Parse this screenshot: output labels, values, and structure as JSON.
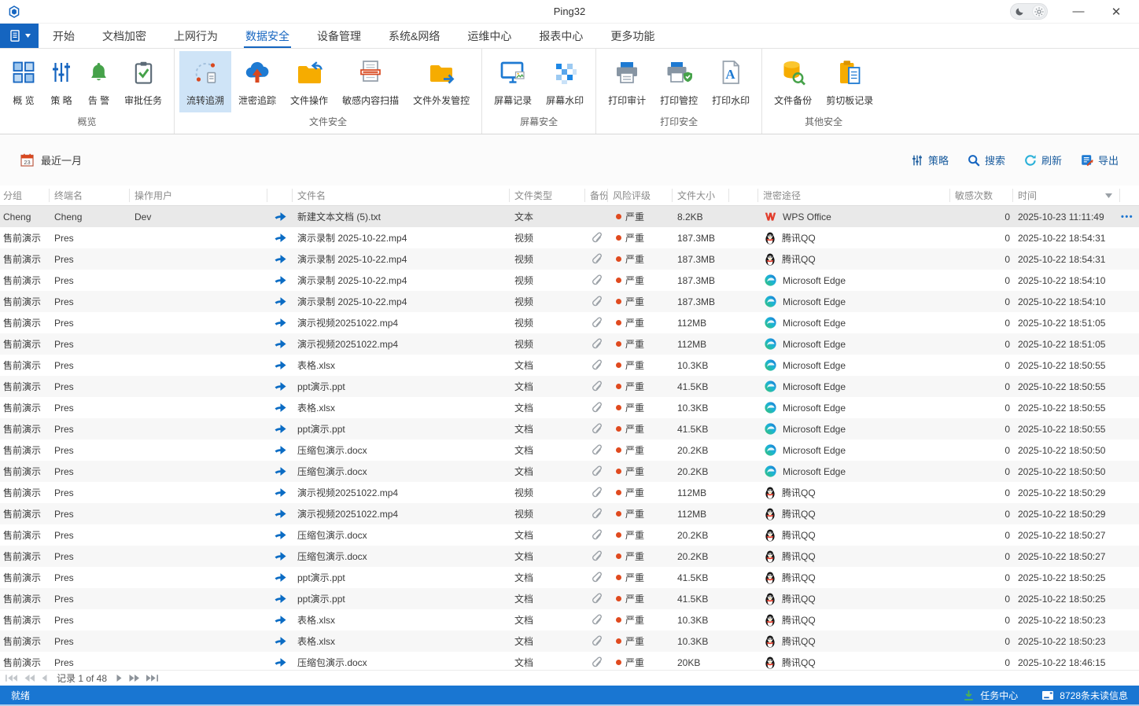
{
  "window": {
    "title": "Ping32"
  },
  "tabs": {
    "active_index": 3,
    "items": [
      {
        "label": "开始"
      },
      {
        "label": "文档加密"
      },
      {
        "label": "上网行为"
      },
      {
        "label": "数据安全"
      },
      {
        "label": "设备管理"
      },
      {
        "label": "系统&网络"
      },
      {
        "label": "运维中心"
      },
      {
        "label": "报表中心"
      },
      {
        "label": "更多功能"
      }
    ]
  },
  "ribbon": {
    "groups": [
      {
        "label": "概览",
        "tools": [
          {
            "label": "概 览",
            "icon": "overview-grid"
          },
          {
            "label": "策 略",
            "icon": "sliders"
          },
          {
            "label": "告 警",
            "icon": "bell"
          },
          {
            "label": "审批任务",
            "icon": "clipboard-check"
          }
        ]
      },
      {
        "label": "文件安全",
        "tools": [
          {
            "label": "流转追溯",
            "icon": "trace-cycle",
            "selected": true
          },
          {
            "label": "泄密追踪",
            "icon": "leak-cloud"
          },
          {
            "label": "文件操作",
            "icon": "folder-back"
          },
          {
            "label": "敏感内容扫描",
            "icon": "doc-scan"
          },
          {
            "label": "文件外发管控",
            "icon": "folder-send"
          }
        ]
      },
      {
        "label": "屏幕安全",
        "tools": [
          {
            "label": "屏幕记录",
            "icon": "screen-record"
          },
          {
            "label": "屏幕水印",
            "icon": "watermark-mosaic"
          }
        ]
      },
      {
        "label": "打印安全",
        "tools": [
          {
            "label": "打印审计",
            "icon": "printer"
          },
          {
            "label": "打印管控",
            "icon": "printer-shield"
          },
          {
            "label": "打印水印",
            "icon": "doc-a"
          }
        ]
      },
      {
        "label": "其他安全",
        "tools": [
          {
            "label": "文件备份",
            "icon": "db-search"
          },
          {
            "label": "剪切板记录",
            "icon": "clipboard-doc"
          }
        ]
      }
    ]
  },
  "filterbar": {
    "date_range": "最近一月",
    "calendar_day": "23",
    "actions": [
      {
        "label": "策略",
        "icon": "sliders-sm"
      },
      {
        "label": "搜索",
        "icon": "search"
      },
      {
        "label": "刷新",
        "icon": "refresh"
      },
      {
        "label": "导出",
        "icon": "export"
      }
    ]
  },
  "table": {
    "columns": [
      {
        "key": "group",
        "label": "分组"
      },
      {
        "key": "terminal",
        "label": "终端名"
      },
      {
        "key": "user",
        "label": "操作用户"
      },
      {
        "key": "arrow",
        "label": ""
      },
      {
        "key": "file",
        "label": "文件名"
      },
      {
        "key": "type",
        "label": "文件类型"
      },
      {
        "key": "backup",
        "label": "备份"
      },
      {
        "key": "risk",
        "label": "风险评级"
      },
      {
        "key": "size",
        "label": "文件大小"
      },
      {
        "key": "gap",
        "label": ""
      },
      {
        "key": "channel",
        "label": "泄密途径"
      },
      {
        "key": "count",
        "label": "敏感次数"
      },
      {
        "key": "time",
        "label": "时间",
        "sortable": true
      },
      {
        "key": "actions",
        "label": ""
      }
    ],
    "rows": [
      {
        "group": "Cheng",
        "terminal": "Cheng",
        "user": "Dev",
        "file": "新建文本文档 (5).txt",
        "type": "文本",
        "backup": false,
        "risk": "严重",
        "size": "8.2KB",
        "channel": "WPS Office",
        "channel_icon": "wps",
        "count": "0",
        "time": "2025-10-23 11:11:49",
        "selected": true
      },
      {
        "group": "售前演示",
        "terminal": "Pres",
        "user": "",
        "file": "演示录制 2025-10-22.mp4",
        "type": "视频",
        "backup": true,
        "risk": "严重",
        "size": "187.3MB",
        "channel": "腾讯QQ",
        "channel_icon": "qq",
        "count": "0",
        "time": "2025-10-22 18:54:31"
      },
      {
        "group": "售前演示",
        "terminal": "Pres",
        "user": "",
        "file": "演示录制 2025-10-22.mp4",
        "type": "视频",
        "backup": true,
        "risk": "严重",
        "size": "187.3MB",
        "channel": "腾讯QQ",
        "channel_icon": "qq",
        "count": "0",
        "time": "2025-10-22 18:54:31"
      },
      {
        "group": "售前演示",
        "terminal": "Pres",
        "user": "",
        "file": "演示录制 2025-10-22.mp4",
        "type": "视频",
        "backup": true,
        "risk": "严重",
        "size": "187.3MB",
        "channel": "Microsoft Edge",
        "channel_icon": "edge",
        "count": "0",
        "time": "2025-10-22 18:54:10"
      },
      {
        "group": "售前演示",
        "terminal": "Pres",
        "user": "",
        "file": "演示录制 2025-10-22.mp4",
        "type": "视频",
        "backup": true,
        "risk": "严重",
        "size": "187.3MB",
        "channel": "Microsoft Edge",
        "channel_icon": "edge",
        "count": "0",
        "time": "2025-10-22 18:54:10"
      },
      {
        "group": "售前演示",
        "terminal": "Pres",
        "user": "",
        "file": "演示视频20251022.mp4",
        "type": "视频",
        "backup": true,
        "risk": "严重",
        "size": "112MB",
        "channel": "Microsoft Edge",
        "channel_icon": "edge",
        "count": "0",
        "time": "2025-10-22 18:51:05"
      },
      {
        "group": "售前演示",
        "terminal": "Pres",
        "user": "",
        "file": "演示视频20251022.mp4",
        "type": "视频",
        "backup": true,
        "risk": "严重",
        "size": "112MB",
        "channel": "Microsoft Edge",
        "channel_icon": "edge",
        "count": "0",
        "time": "2025-10-22 18:51:05"
      },
      {
        "group": "售前演示",
        "terminal": "Pres",
        "user": "",
        "file": "表格.xlsx",
        "type": "文档",
        "backup": true,
        "risk": "严重",
        "size": "10.3KB",
        "channel": "Microsoft Edge",
        "channel_icon": "edge",
        "count": "0",
        "time": "2025-10-22 18:50:55"
      },
      {
        "group": "售前演示",
        "terminal": "Pres",
        "user": "",
        "file": "ppt演示.ppt",
        "type": "文档",
        "backup": true,
        "risk": "严重",
        "size": "41.5KB",
        "channel": "Microsoft Edge",
        "channel_icon": "edge",
        "count": "0",
        "time": "2025-10-22 18:50:55"
      },
      {
        "group": "售前演示",
        "terminal": "Pres",
        "user": "",
        "file": "表格.xlsx",
        "type": "文档",
        "backup": true,
        "risk": "严重",
        "size": "10.3KB",
        "channel": "Microsoft Edge",
        "channel_icon": "edge",
        "count": "0",
        "time": "2025-10-22 18:50:55"
      },
      {
        "group": "售前演示",
        "terminal": "Pres",
        "user": "",
        "file": "ppt演示.ppt",
        "type": "文档",
        "backup": true,
        "risk": "严重",
        "size": "41.5KB",
        "channel": "Microsoft Edge",
        "channel_icon": "edge",
        "count": "0",
        "time": "2025-10-22 18:50:55"
      },
      {
        "group": "售前演示",
        "terminal": "Pres",
        "user": "",
        "file": "压缩包演示.docx",
        "type": "文档",
        "backup": true,
        "risk": "严重",
        "size": "20.2KB",
        "channel": "Microsoft Edge",
        "channel_icon": "edge",
        "count": "0",
        "time": "2025-10-22 18:50:50"
      },
      {
        "group": "售前演示",
        "terminal": "Pres",
        "user": "",
        "file": "压缩包演示.docx",
        "type": "文档",
        "backup": true,
        "risk": "严重",
        "size": "20.2KB",
        "channel": "Microsoft Edge",
        "channel_icon": "edge",
        "count": "0",
        "time": "2025-10-22 18:50:50"
      },
      {
        "group": "售前演示",
        "terminal": "Pres",
        "user": "",
        "file": "演示视频20251022.mp4",
        "type": "视频",
        "backup": true,
        "risk": "严重",
        "size": "112MB",
        "channel": "腾讯QQ",
        "channel_icon": "qq",
        "count": "0",
        "time": "2025-10-22 18:50:29"
      },
      {
        "group": "售前演示",
        "terminal": "Pres",
        "user": "",
        "file": "演示视频20251022.mp4",
        "type": "视频",
        "backup": true,
        "risk": "严重",
        "size": "112MB",
        "channel": "腾讯QQ",
        "channel_icon": "qq",
        "count": "0",
        "time": "2025-10-22 18:50:29"
      },
      {
        "group": "售前演示",
        "terminal": "Pres",
        "user": "",
        "file": "压缩包演示.docx",
        "type": "文档",
        "backup": true,
        "risk": "严重",
        "size": "20.2KB",
        "channel": "腾讯QQ",
        "channel_icon": "qq",
        "count": "0",
        "time": "2025-10-22 18:50:27"
      },
      {
        "group": "售前演示",
        "terminal": "Pres",
        "user": "",
        "file": "压缩包演示.docx",
        "type": "文档",
        "backup": true,
        "risk": "严重",
        "size": "20.2KB",
        "channel": "腾讯QQ",
        "channel_icon": "qq",
        "count": "0",
        "time": "2025-10-22 18:50:27"
      },
      {
        "group": "售前演示",
        "terminal": "Pres",
        "user": "",
        "file": "ppt演示.ppt",
        "type": "文档",
        "backup": true,
        "risk": "严重",
        "size": "41.5KB",
        "channel": "腾讯QQ",
        "channel_icon": "qq",
        "count": "0",
        "time": "2025-10-22 18:50:25"
      },
      {
        "group": "售前演示",
        "terminal": "Pres",
        "user": "",
        "file": "ppt演示.ppt",
        "type": "文档",
        "backup": true,
        "risk": "严重",
        "size": "41.5KB",
        "channel": "腾讯QQ",
        "channel_icon": "qq",
        "count": "0",
        "time": "2025-10-22 18:50:25"
      },
      {
        "group": "售前演示",
        "terminal": "Pres",
        "user": "",
        "file": "表格.xlsx",
        "type": "文档",
        "backup": true,
        "risk": "严重",
        "size": "10.3KB",
        "channel": "腾讯QQ",
        "channel_icon": "qq",
        "count": "0",
        "time": "2025-10-22 18:50:23"
      },
      {
        "group": "售前演示",
        "terminal": "Pres",
        "user": "",
        "file": "表格.xlsx",
        "type": "文档",
        "backup": true,
        "risk": "严重",
        "size": "10.3KB",
        "channel": "腾讯QQ",
        "channel_icon": "qq",
        "count": "0",
        "time": "2025-10-22 18:50:23"
      },
      {
        "group": "售前演示",
        "terminal": "Pres",
        "user": "",
        "file": "压缩包演示.docx",
        "type": "文档",
        "backup": true,
        "risk": "严重",
        "size": "20KB",
        "channel": "腾讯QQ",
        "channel_icon": "qq",
        "count": "0",
        "time": "2025-10-22 18:46:15"
      }
    ]
  },
  "pagination": {
    "record_label": "记录 1 of 48"
  },
  "statusbar": {
    "ready": "就绪",
    "task_center": "任务中心",
    "unread": "8728条未读信息"
  },
  "colors": {
    "accent": "#1565c0",
    "statusbar_bg": "#1976d2",
    "selected_tool_bg": "#cfe4f7",
    "risk_dot": "#e04a1f",
    "selected_row_bg": "#e9e9e9"
  }
}
